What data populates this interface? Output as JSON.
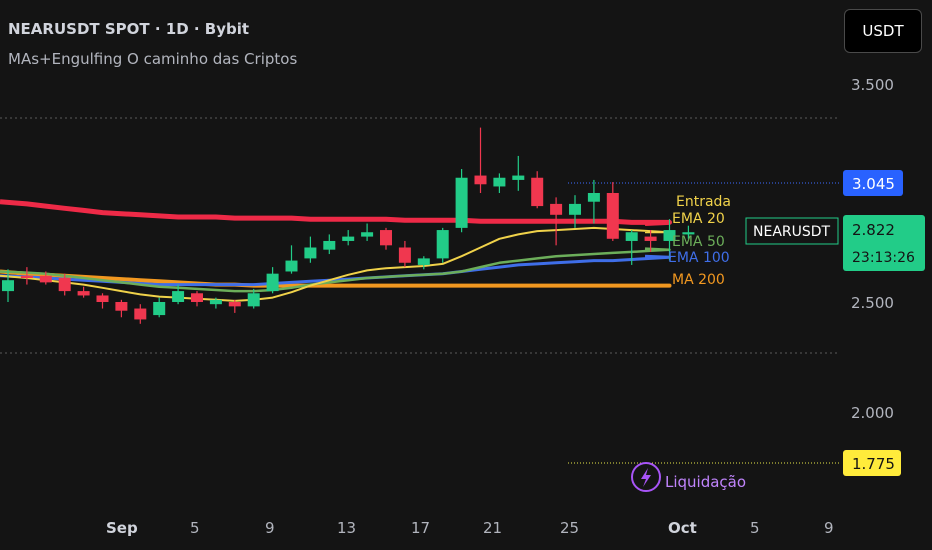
{
  "header": {
    "title": "NEARUSDT SPOT · 1D · Bybit",
    "indicator": "MAs+Engulfing O caminho das Criptos"
  },
  "currency_button": "USDT",
  "symbol_label": "NEARUSDT",
  "countdown": "23:13:26",
  "colors": {
    "background": "#141414",
    "up": "#22cc88",
    "down": "#f0374f",
    "ma_red": "#ee2a47",
    "ema20": "#f0d24a",
    "ema50": "#6cae5a",
    "ema100": "#3f6ee8",
    "ma200": "#f29820",
    "entry_line": "#3b6bff",
    "liq_line": "#e6e64a",
    "liq_icon": "#a855f7"
  },
  "chart_data": {
    "type": "candlestick",
    "xlabels": [
      "Sep",
      "5",
      "9",
      "13",
      "17",
      "21",
      "25",
      "Oct",
      "5",
      "9"
    ],
    "ylabels": [
      "3.500",
      "2.500",
      "2.000"
    ],
    "ylim": [
      1.5,
      3.75
    ],
    "series_labels": [
      {
        "name": "Entrada",
        "color": "#f0d24a"
      },
      {
        "name": "EMA 20",
        "color": "#f0d24a"
      },
      {
        "name": "EMA 50",
        "color": "#6cae5a"
      },
      {
        "name": "EMA 100",
        "color": "#3f6ee8"
      },
      {
        "name": "MA 200",
        "color": "#f29820"
      }
    ],
    "price_labels": {
      "entry": "3.045",
      "current": "2.822",
      "liquidation": "1.775"
    },
    "liquidation_label": "Liquidação",
    "candles": [
      {
        "o": 2.55,
        "h": 2.65,
        "l": 2.5,
        "c": 2.6
      },
      {
        "o": 2.62,
        "h": 2.66,
        "l": 2.58,
        "c": 2.61
      },
      {
        "o": 2.62,
        "h": 2.64,
        "l": 2.58,
        "c": 2.59
      },
      {
        "o": 2.61,
        "h": 2.63,
        "l": 2.53,
        "c": 2.55
      },
      {
        "o": 2.55,
        "h": 2.57,
        "l": 2.52,
        "c": 2.53
      },
      {
        "o": 2.53,
        "h": 2.54,
        "l": 2.47,
        "c": 2.5
      },
      {
        "o": 2.5,
        "h": 2.51,
        "l": 2.43,
        "c": 2.46
      },
      {
        "o": 2.47,
        "h": 2.49,
        "l": 2.4,
        "c": 2.42
      },
      {
        "o": 2.44,
        "h": 2.52,
        "l": 2.43,
        "c": 2.5
      },
      {
        "o": 2.5,
        "h": 2.58,
        "l": 2.49,
        "c": 2.55
      },
      {
        "o": 2.54,
        "h": 2.55,
        "l": 2.48,
        "c": 2.5
      },
      {
        "o": 2.49,
        "h": 2.52,
        "l": 2.47,
        "c": 2.51
      },
      {
        "o": 2.5,
        "h": 2.51,
        "l": 2.45,
        "c": 2.48
      },
      {
        "o": 2.48,
        "h": 2.56,
        "l": 2.47,
        "c": 2.54
      },
      {
        "o": 2.55,
        "h": 2.66,
        "l": 2.54,
        "c": 2.63
      },
      {
        "o": 2.64,
        "h": 2.76,
        "l": 2.63,
        "c": 2.69
      },
      {
        "o": 2.7,
        "h": 2.8,
        "l": 2.68,
        "c": 2.75
      },
      {
        "o": 2.74,
        "h": 2.81,
        "l": 2.72,
        "c": 2.78
      },
      {
        "o": 2.78,
        "h": 2.83,
        "l": 2.76,
        "c": 2.8
      },
      {
        "o": 2.8,
        "h": 2.86,
        "l": 2.78,
        "c": 2.82
      },
      {
        "o": 2.83,
        "h": 2.84,
        "l": 2.74,
        "c": 2.76
      },
      {
        "o": 2.75,
        "h": 2.78,
        "l": 2.66,
        "c": 2.68
      },
      {
        "o": 2.67,
        "h": 2.71,
        "l": 2.65,
        "c": 2.7
      },
      {
        "o": 2.7,
        "h": 2.84,
        "l": 2.68,
        "c": 2.83
      },
      {
        "o": 2.84,
        "h": 3.11,
        "l": 2.82,
        "c": 3.07
      },
      {
        "o": 3.08,
        "h": 3.3,
        "l": 3.0,
        "c": 3.04
      },
      {
        "o": 3.03,
        "h": 3.09,
        "l": 3.0,
        "c": 3.07
      },
      {
        "o": 3.06,
        "h": 3.17,
        "l": 3.01,
        "c": 3.08
      },
      {
        "o": 3.07,
        "h": 3.1,
        "l": 2.93,
        "c": 2.94
      },
      {
        "o": 2.95,
        "h": 2.98,
        "l": 2.76,
        "c": 2.9
      },
      {
        "o": 2.9,
        "h": 2.99,
        "l": 2.84,
        "c": 2.95
      },
      {
        "o": 2.96,
        "h": 3.06,
        "l": 2.86,
        "c": 3.0
      },
      {
        "o": 3.0,
        "h": 3.05,
        "l": 2.78,
        "c": 2.79
      },
      {
        "o": 2.78,
        "h": 2.83,
        "l": 2.67,
        "c": 2.82
      },
      {
        "o": 2.8,
        "h": 2.83,
        "l": 2.73,
        "c": 2.78
      },
      {
        "o": 2.78,
        "h": 2.88,
        "l": 2.69,
        "c": 2.83
      },
      {
        "o": 2.81,
        "h": 2.85,
        "l": 2.79,
        "c": 2.82
      }
    ],
    "lines": {
      "ma_red": [
        2.96,
        2.95,
        2.94,
        2.93,
        2.92,
        2.91,
        2.905,
        2.9,
        2.895,
        2.89,
        2.89,
        2.89,
        2.885,
        2.885,
        2.885,
        2.885,
        2.88,
        2.88,
        2.88,
        2.88,
        2.88,
        2.875,
        2.875,
        2.875,
        2.875,
        2.87,
        2.87,
        2.87,
        2.87,
        2.87,
        2.87,
        2.87,
        2.87,
        2.865,
        2.865,
        2.865,
        2.86
      ],
      "ema20": [
        2.62,
        2.61,
        2.6,
        2.59,
        2.58,
        2.565,
        2.55,
        2.535,
        2.525,
        2.52,
        2.515,
        2.51,
        2.505,
        2.51,
        2.52,
        2.545,
        2.575,
        2.6,
        2.625,
        2.645,
        2.655,
        2.66,
        2.665,
        2.675,
        2.71,
        2.75,
        2.79,
        2.81,
        2.825,
        2.83,
        2.835,
        2.84,
        2.835,
        2.83,
        2.825,
        2.82,
        2.82
      ],
      "ema50": [
        2.64,
        2.635,
        2.63,
        2.62,
        2.61,
        2.6,
        2.59,
        2.58,
        2.57,
        2.565,
        2.56,
        2.555,
        2.55,
        2.55,
        2.555,
        2.565,
        2.58,
        2.59,
        2.6,
        2.61,
        2.615,
        2.62,
        2.625,
        2.63,
        2.64,
        2.66,
        2.68,
        2.69,
        2.7,
        2.71,
        2.715,
        2.72,
        2.725,
        2.73,
        2.735,
        2.74,
        2.745
      ],
      "ema100": [
        2.62,
        2.615,
        2.61,
        2.605,
        2.6,
        2.595,
        2.59,
        2.585,
        2.58,
        2.58,
        2.58,
        2.58,
        2.58,
        2.58,
        2.585,
        2.59,
        2.595,
        2.6,
        2.605,
        2.61,
        2.615,
        2.62,
        2.625,
        2.63,
        2.64,
        2.65,
        2.66,
        2.67,
        2.675,
        2.68,
        2.685,
        2.69,
        2.69,
        2.695,
        2.7,
        2.705,
        2.71
      ],
      "ma200": [
        2.64,
        2.63,
        2.625,
        2.62,
        2.615,
        2.61,
        2.605,
        2.6,
        2.595,
        2.59,
        2.585,
        2.58,
        2.58,
        2.575,
        2.575,
        2.575,
        2.575,
        2.575,
        2.575,
        2.575,
        2.575,
        2.575,
        2.575,
        2.575,
        2.575,
        2.575,
        2.575,
        2.575,
        2.575,
        2.575,
        2.575,
        2.575,
        2.575,
        2.575,
        2.575,
        2.575,
        2.575
      ]
    }
  }
}
